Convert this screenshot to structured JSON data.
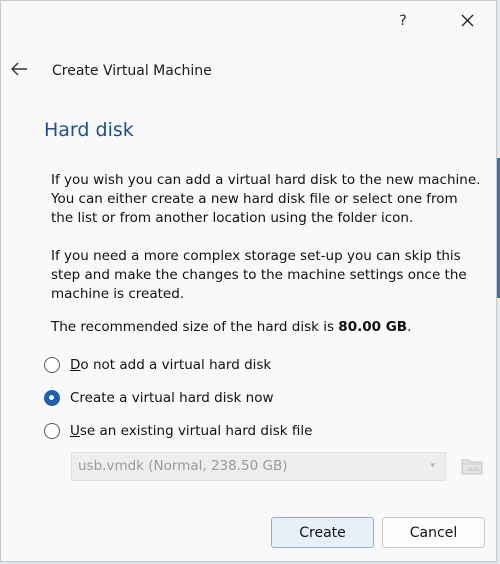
{
  "titlebar": {
    "help_label": "?",
    "close_icon": "close-icon"
  },
  "header": {
    "back_icon": "arrow-left-icon",
    "title": "Create Virtual Machine"
  },
  "page": {
    "heading": "Hard disk",
    "paragraph1": "If you wish you can add a virtual hard disk to the new machine. You can either create a new hard disk file or select one from the list or from another location using the folder icon.",
    "paragraph2": "If you need a more complex storage set-up you can skip this step and make the changes to the machine settings once the machine is created.",
    "recommended_prefix": "The recommended size of the hard disk is ",
    "recommended_size": "80.00 GB",
    "recommended_suffix": "."
  },
  "options": [
    {
      "mnemonic": "D",
      "rest": "o not add a virtual hard disk",
      "selected": false
    },
    {
      "mnemonic": "",
      "rest": "Create a virtual hard disk now",
      "selected": true
    },
    {
      "mnemonic": "U",
      "rest": "se an existing virtual hard disk file",
      "selected": false
    }
  ],
  "disk_select": {
    "value": "usb.vmdk (Normal, 238.50 GB)",
    "disabled": true
  },
  "footer": {
    "create_label": "Create",
    "cancel_label": "Cancel"
  },
  "colors": {
    "accent": "#1f5fae",
    "heading": "#1f4e8c"
  }
}
